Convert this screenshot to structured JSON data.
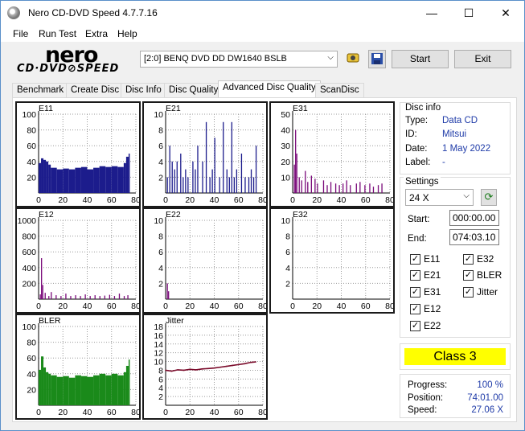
{
  "window": {
    "title": "Nero CD-DVD Speed 4.7.7.16",
    "minimize_glyph": "—",
    "maximize_glyph": "☐",
    "close_glyph": "✕"
  },
  "menu": [
    "File",
    "Run Test",
    "Extra",
    "Help"
  ],
  "logo": {
    "top": "nero",
    "bottom": "CD·DVD⊘SPEED"
  },
  "toolbar": {
    "drive": "[2:0]   BENQ DVD DD DW1640 BSLB",
    "start_label": "Start",
    "exit_label": "Exit"
  },
  "tabs": [
    "Benchmark",
    "Create Disc",
    "Disc Info",
    "Disc Quality",
    "Advanced Disc Quality",
    "ScanDisc"
  ],
  "active_tab": "Advanced Disc Quality",
  "disc_info": {
    "heading": "Disc info",
    "type_label": "Type:",
    "type_value": "Data CD",
    "id_label": "ID:",
    "id_value": "Mitsui",
    "date_label": "Date:",
    "date_value": "1 May 2022",
    "label_label": "Label:",
    "label_value": "-"
  },
  "settings": {
    "heading": "Settings",
    "speed": "24 X",
    "start_label": "Start:",
    "start_value": "000:00.00",
    "end_label": "End:",
    "end_value": "074:03.10",
    "checks": [
      {
        "label": "E11",
        "checked": true
      },
      {
        "label": "E32",
        "checked": true
      },
      {
        "label": "E21",
        "checked": true
      },
      {
        "label": "BLER",
        "checked": true
      },
      {
        "label": "E31",
        "checked": true
      },
      {
        "label": "Jitter",
        "checked": true
      },
      {
        "label": "E12",
        "checked": true
      },
      {
        "label": "E22",
        "checked": true
      }
    ]
  },
  "class_label": "Class 3",
  "stats": {
    "progress_label": "Progress:",
    "progress_value": "100 %",
    "position_label": "Position:",
    "position_value": "74:01.00",
    "speed_label": "Speed:",
    "speed_value": "27.06 X"
  },
  "colors": {
    "navy": "#1c1c8c",
    "purple": "#7a0a7a",
    "green": "#1a8a1a",
    "maroon": "#7a0a2a",
    "class_bg": "#ffff00",
    "link_blue": "#1f3ba8"
  },
  "chart_data": [
    {
      "name": "E11",
      "type": "bar",
      "color": "#1c1c8c",
      "ylim": [
        0,
        100
      ],
      "yticks": [
        20,
        40,
        60,
        80,
        100
      ],
      "xticks": [
        0,
        20,
        40,
        60,
        80
      ],
      "xlim": [
        0,
        80
      ],
      "x": [
        0,
        2,
        4,
        6,
        8,
        10,
        15,
        20,
        25,
        30,
        35,
        40,
        45,
        50,
        55,
        60,
        65,
        70,
        72,
        74
      ],
      "values": [
        38,
        44,
        42,
        40,
        36,
        32,
        30,
        31,
        30,
        32,
        33,
        30,
        32,
        34,
        33,
        34,
        33,
        38,
        46,
        50
      ]
    },
    {
      "name": "E21",
      "type": "bar",
      "color": "#1c1c8c",
      "ylim": [
        0,
        10
      ],
      "yticks": [
        2,
        4,
        6,
        8,
        10
      ],
      "xticks": [
        0,
        20,
        40,
        60,
        80
      ],
      "xlim": [
        0,
        80
      ],
      "x": [
        1,
        3,
        5,
        7,
        9,
        12,
        14,
        16,
        18,
        22,
        24,
        26,
        30,
        33,
        36,
        38,
        40,
        44,
        47,
        50,
        52,
        54,
        56,
        58,
        62,
        65,
        68,
        70,
        72,
        74
      ],
      "values": [
        2,
        6,
        4,
        3,
        4,
        5,
        2,
        3,
        2,
        4,
        3,
        6,
        4,
        9,
        2,
        3,
        7,
        2,
        9,
        3,
        2,
        9,
        2,
        3,
        5,
        2,
        2,
        3,
        2,
        6
      ]
    },
    {
      "name": "E31",
      "type": "bar",
      "color": "#7a0a7a",
      "ylim": [
        0,
        50
      ],
      "yticks": [
        10,
        20,
        30,
        40,
        50
      ],
      "xticks": [
        0,
        20,
        40,
        60,
        80
      ],
      "xlim": [
        0,
        80
      ],
      "x": [
        1,
        2,
        3,
        5,
        7,
        10,
        12,
        15,
        18,
        20,
        25,
        28,
        31,
        35,
        38,
        41,
        44,
        47,
        52,
        55,
        59,
        63,
        66,
        70,
        73
      ],
      "values": [
        18,
        40,
        25,
        10,
        8,
        14,
        7,
        11,
        9,
        6,
        8,
        5,
        7,
        6,
        5,
        6,
        8,
        5,
        6,
        7,
        5,
        6,
        4,
        5,
        6
      ]
    },
    {
      "name": "E12",
      "type": "bar",
      "color": "#7a0a7a",
      "ylim": [
        0,
        1000
      ],
      "yticks": [
        200,
        400,
        600,
        800,
        1000
      ],
      "xticks": [
        0,
        20,
        40,
        60,
        80
      ],
      "xlim": [
        0,
        80
      ],
      "x": [
        1,
        2,
        3,
        5,
        8,
        10,
        14,
        18,
        22,
        26,
        30,
        34,
        38,
        42,
        46,
        50,
        54,
        58,
        62,
        66,
        70,
        73
      ],
      "values": [
        60,
        520,
        180,
        80,
        40,
        90,
        50,
        40,
        70,
        40,
        50,
        40,
        60,
        40,
        50,
        40,
        45,
        55,
        40,
        70,
        40,
        50
      ]
    },
    {
      "name": "E22",
      "type": "bar",
      "color": "#7a0a7a",
      "ylim": [
        0,
        10
      ],
      "yticks": [
        2,
        4,
        6,
        8,
        10
      ],
      "xticks": [
        0,
        20,
        40,
        60,
        80
      ],
      "xlim": [
        0,
        80
      ],
      "x": [
        1,
        2
      ],
      "values": [
        2,
        1
      ]
    },
    {
      "name": "E32",
      "type": "bar",
      "color": "#7a0a7a",
      "ylim": [
        0,
        10
      ],
      "yticks": [
        2,
        4,
        6,
        8,
        10
      ],
      "xticks": [
        0,
        20,
        40,
        60,
        80
      ],
      "xlim": [
        0,
        80
      ],
      "x": [],
      "values": []
    },
    {
      "name": "BLER",
      "type": "bar",
      "color": "#1a8a1a",
      "ylim": [
        0,
        100
      ],
      "yticks": [
        20,
        40,
        60,
        80,
        100
      ],
      "xticks": [
        0,
        20,
        40,
        60,
        80
      ],
      "xlim": [
        0,
        80
      ],
      "x": [
        0,
        2,
        4,
        6,
        8,
        10,
        15,
        20,
        25,
        30,
        35,
        40,
        45,
        50,
        55,
        60,
        65,
        70,
        72,
        74
      ],
      "values": [
        45,
        62,
        48,
        42,
        40,
        38,
        36,
        37,
        35,
        38,
        37,
        36,
        38,
        40,
        38,
        40,
        38,
        42,
        50,
        58
      ]
    },
    {
      "name": "Jitter",
      "type": "line",
      "color": "#7a0a2a",
      "ylim": [
        0,
        18
      ],
      "yticks": [
        2,
        4,
        6,
        8,
        10,
        12,
        14,
        16,
        18
      ],
      "xticks": [
        0,
        20,
        40,
        60,
        80
      ],
      "xlim": [
        0,
        80
      ],
      "x": [
        0,
        5,
        10,
        15,
        20,
        25,
        30,
        35,
        40,
        45,
        50,
        55,
        60,
        65,
        70,
        74
      ],
      "values": [
        8.0,
        7.8,
        8.1,
        8.0,
        8.2,
        8.1,
        8.3,
        8.4,
        8.5,
        8.7,
        8.9,
        9.1,
        9.3,
        9.5,
        9.8,
        9.9
      ]
    }
  ]
}
